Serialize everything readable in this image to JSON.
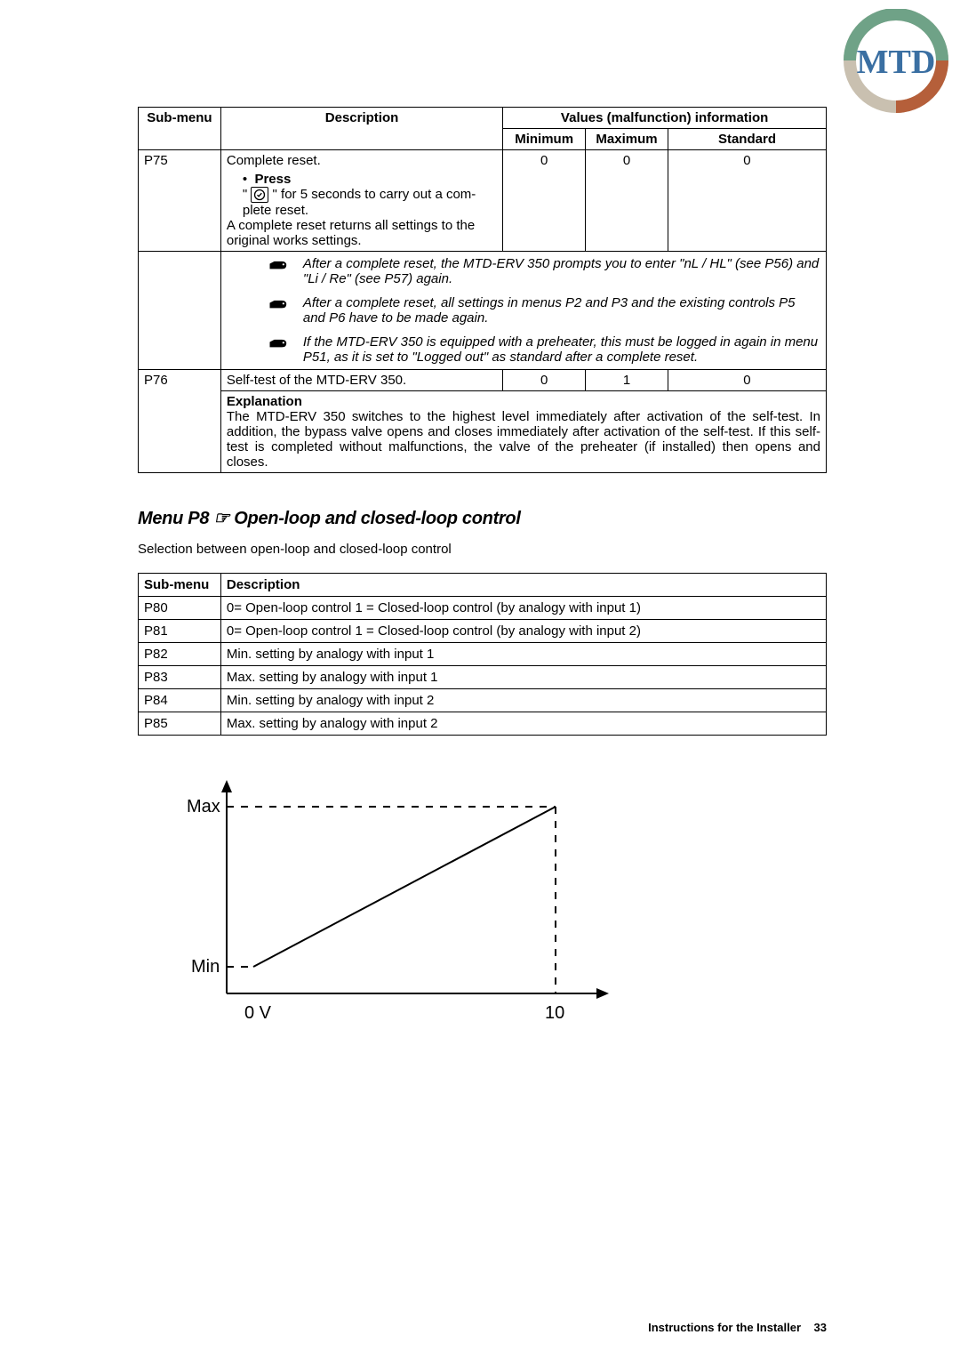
{
  "logo_text": "MTD",
  "table1": {
    "head": {
      "submenu": "Sub-menu",
      "desc": "Description",
      "values_span": "Values (malfunction) information",
      "min": "Minimum",
      "max": "Maximum",
      "std": "Standard"
    },
    "p75": {
      "id": "P75",
      "l1": "Complete reset.",
      "press_label": "Press",
      "press_before": "\"",
      "press_after": "\" for 5 seconds to carry out a com-",
      "l3": "plete reset.",
      "l4": "A complete reset returns all settings to the original works settings.",
      "min": "0",
      "max": "0",
      "std": "0"
    },
    "notes": [
      "After a complete reset, the MTD-ERV 350 prompts you to enter \"nL / HL\" (see P56) and \"Li / Re\" (see P57) again.",
      "After a complete reset, all settings in menus P2 and P3 and the existing controls P5 and P6 have to be made again.",
      "If the  MTD-ERV 350 is equipped with a preheater, this must be logged in again in menu P51, as it is set to \"Logged out\" as standard after a complete reset."
    ],
    "p76": {
      "id": "P76",
      "l1": "Self-test of the MTD-ERV 350.",
      "min": "0",
      "max": "1",
      "std": "0",
      "exp_label": "Explanation",
      "exp_text": "The MTD-ERV 350 switches to the highest level immediately after activation of the self-test. In addition, the bypass valve opens and closes immediately after activation of the self-test. If this self-test is completed without malfunctions, the valve of the preheater (if installed) then opens and closes."
    }
  },
  "section_heading": "Menu P8 ☞ Open-loop and closed-loop control",
  "section_intro": "Selection between open-loop and closed-loop control",
  "table2": {
    "head": {
      "submenu": "Sub-menu",
      "desc": "Description"
    },
    "rows": [
      {
        "id": "P80",
        "desc": "0= Open-loop control 1 = Closed-loop control (by analogy with input 1)"
      },
      {
        "id": "P81",
        "desc": "0= Open-loop control 1 = Closed-loop control (by analogy with input 2)"
      },
      {
        "id": "P82",
        "desc": "Min. setting by analogy with input 1"
      },
      {
        "id": "P83",
        "desc": "Max. setting by analogy with input 1"
      },
      {
        "id": "P84",
        "desc": "Min. setting by analogy with input 2"
      },
      {
        "id": "P85",
        "desc": "Max. setting by analogy with input 2"
      }
    ]
  },
  "chart_data": {
    "type": "line",
    "title": "",
    "xlabel": "",
    "ylabel": "",
    "x_ticks": [
      "0 V",
      "10"
    ],
    "y_ticks": [
      "Min",
      "Max"
    ],
    "x": [
      0,
      10
    ],
    "values": [
      0,
      1
    ],
    "ylim": [
      0,
      1
    ],
    "xlim": [
      0,
      10
    ],
    "description": "Linear ramp from Min at 0 V to Max at 10 V"
  },
  "footer": {
    "text": "Instructions for the Installer",
    "page": "33"
  }
}
